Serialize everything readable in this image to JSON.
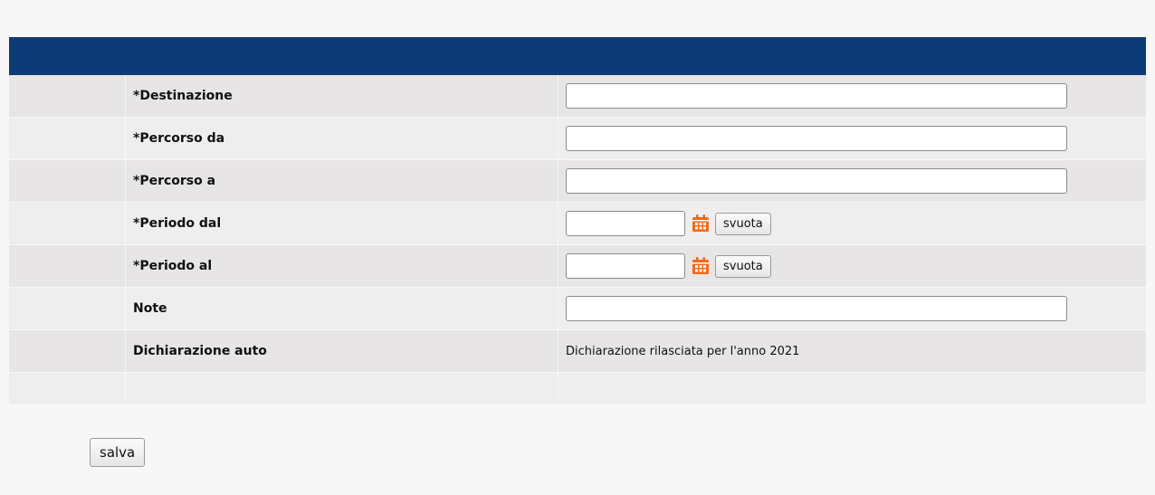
{
  "form": {
    "rows": [
      {
        "label": "*Destinazione",
        "value": ""
      },
      {
        "label": "*Percorso da",
        "value": ""
      },
      {
        "label": "*Percorso a",
        "value": ""
      },
      {
        "label": "*Periodo dal",
        "value": "",
        "clear_label": "svuota"
      },
      {
        "label": "*Periodo al",
        "value": "",
        "clear_label": "svuota"
      },
      {
        "label": "Note",
        "value": ""
      },
      {
        "label": "Dichiarazione auto",
        "value": "Dichiarazione rilasciata per l'anno 2021"
      }
    ]
  },
  "actions": {
    "save_label": "salva"
  },
  "icons": {
    "calendar": "calendar-icon"
  },
  "colors": {
    "header_bar": "#0d3b78",
    "calendar_icon": "#f26a1b"
  }
}
